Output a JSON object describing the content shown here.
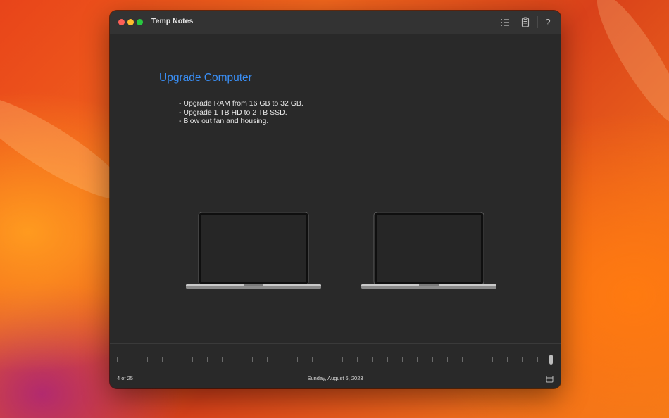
{
  "window": {
    "title": "Temp Notes"
  },
  "toolbar": {
    "list_icon": "list-icon",
    "clipboard_icon": "clipboard-icon",
    "help_label": "?"
  },
  "note": {
    "title": "Upgrade Computer",
    "lines": [
      "- Upgrade RAM from 16 GB to 32 GB.",
      "- Upgrade 1 TB HD to 2 TB SSD.",
      "- Blow out fan and housing."
    ]
  },
  "footer": {
    "position": "4 of 25",
    "date": "Sunday, August 6, 2023",
    "calendar_icon": "calendar-icon"
  },
  "timeline": {
    "total": 25,
    "current": 4
  },
  "colors": {
    "title_accent": "#3a8ff6",
    "window_bg": "#292929",
    "close": "#fe5f57",
    "minimize": "#febc2e",
    "maximize": "#28c840"
  }
}
